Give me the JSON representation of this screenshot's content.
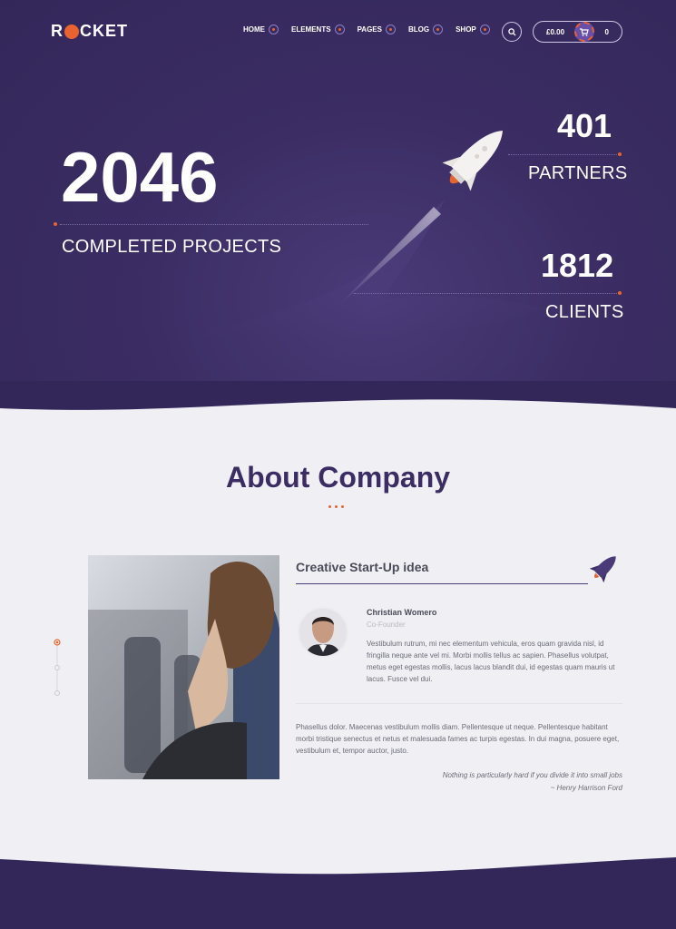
{
  "logo": {
    "text_before": "R",
    "text_after": "CKET"
  },
  "nav": {
    "items": [
      "HOME",
      "ELEMENTS",
      "PAGES",
      "BLOG",
      "SHOP"
    ],
    "search_icon": "search-icon",
    "cart_price": "£0.00",
    "cart_count": "0"
  },
  "stats": {
    "projects": {
      "value": "2046",
      "label": "COMPLETED PROJECTS"
    },
    "partners": {
      "value": "401",
      "label": "PARTNERS"
    },
    "clients": {
      "value": "1812",
      "label": "CLIENTS"
    }
  },
  "about": {
    "title": "About Company",
    "subtitle": "Creative Start-Up idea",
    "person_name": "Christian Womero",
    "person_role": "Co-Founder",
    "bio": "Vestibulum rutrum, mi nec elementum vehicula, eros quam gravida nisl, id fringilla neque ante vel mi. Morbi mollis tellus ac sapien. Phasellus volutpat, metus eget egestas mollis, lacus lacus blandit dui, id egestas quam mauris ut lacus. Fusce vel dui.",
    "body": "Phasellus dolor. Maecenas vestibulum mollis diam. Pellentesque ut neque. Pellentesque habitant morbi tristique senectus et netus et malesuada fames ac turpis egestas. In dui magna, posuere eget, vestibulum et, tempor auctor, justo.",
    "quote_text": "Nothing is particularly hard if you divide it into small jobs",
    "quote_author": "~ Henry Harrison Ford"
  },
  "colors": {
    "accent": "#e8632f",
    "brand": "#3b2d63"
  }
}
